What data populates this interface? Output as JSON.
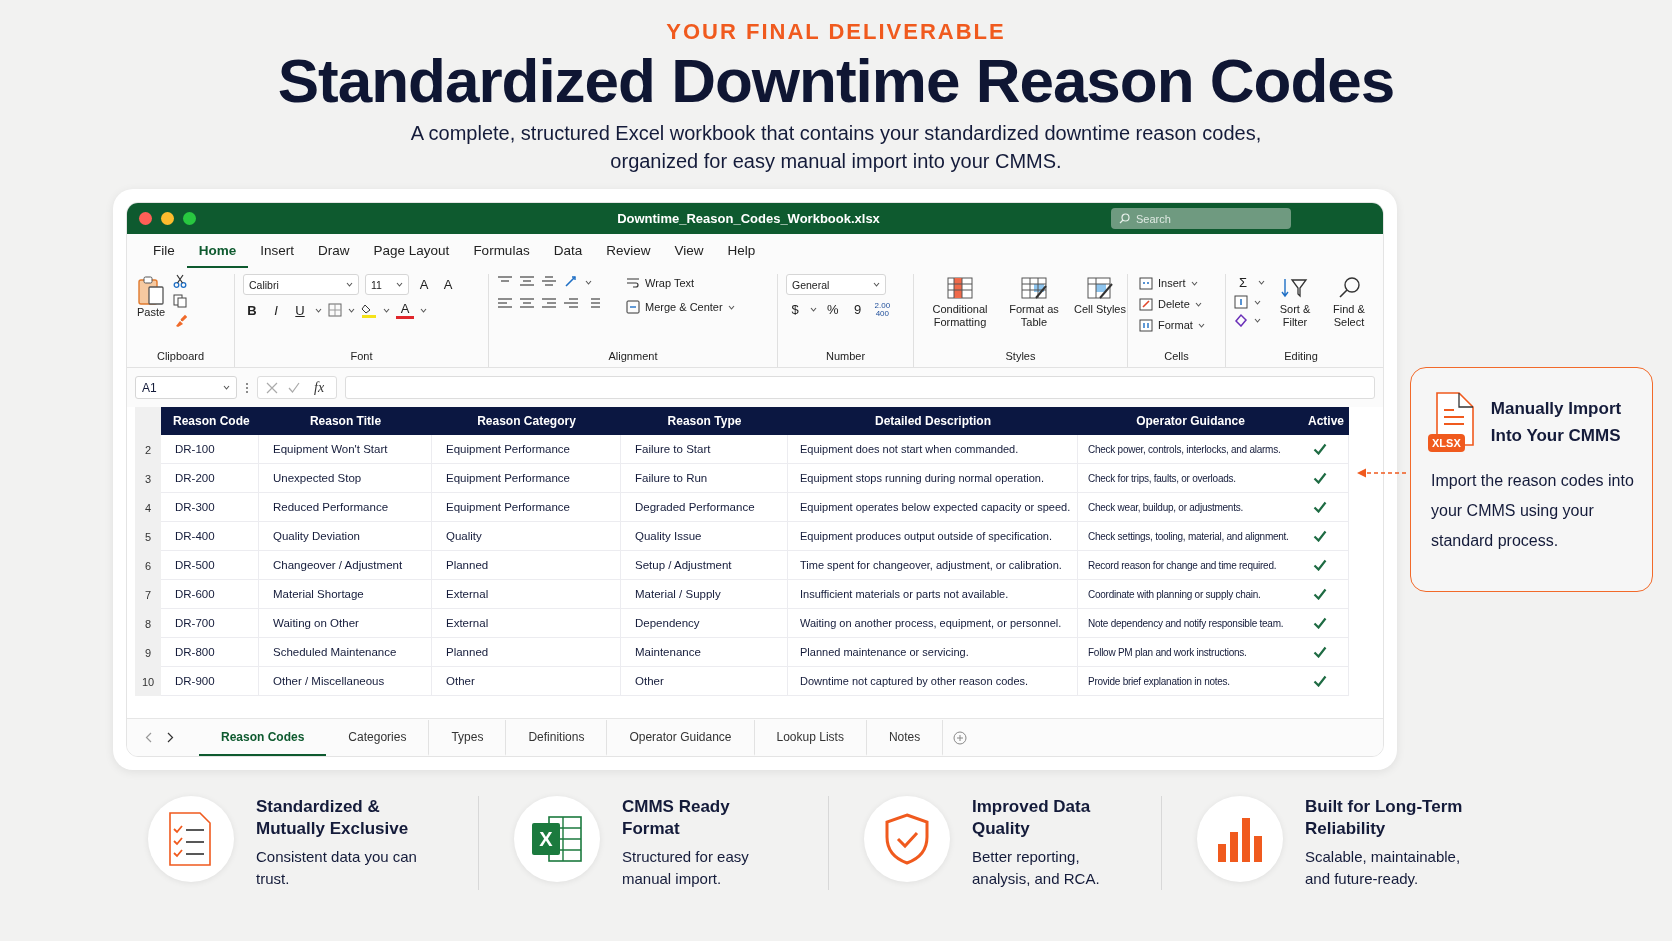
{
  "header": {
    "eyebrow": "YOUR FINAL DELIVERABLE",
    "title": "Standardized Downtime Reason Codes",
    "subtitle": "A complete, structured Excel workbook that contains your standardized downtime reason codes, organized for easy manual import into your CMMS."
  },
  "window": {
    "title": "Downtime_Reason_Codes_Workbook.xlsx",
    "search": {
      "placeholder": "Search"
    }
  },
  "menu": [
    {
      "label": "File",
      "selected": false
    },
    {
      "label": "Home",
      "selected": true
    },
    {
      "label": "Insert",
      "selected": false
    },
    {
      "label": "Draw",
      "selected": false
    },
    {
      "label": "Page Layout",
      "selected": false
    },
    {
      "label": "Formulas",
      "selected": false
    },
    {
      "label": "Data",
      "selected": false
    },
    {
      "label": "Review",
      "selected": false
    },
    {
      "label": "View",
      "selected": false
    },
    {
      "label": "Help",
      "selected": false
    }
  ],
  "ribbon": {
    "clipboard": {
      "paste": "Paste",
      "label": "Clipboard"
    },
    "font": {
      "name": "Calibri",
      "size": "11",
      "grow": "A",
      "shrink": "A",
      "bold": "B",
      "italic": "I",
      "underline": "U",
      "color_letter": "A",
      "label": "Font"
    },
    "alignment": {
      "wrap": "Wrap Text",
      "merge": "Merge & Center",
      "label": "Alignment"
    },
    "number": {
      "format": "General",
      "currency": "$",
      "percent": "%",
      "comma": "9",
      "decimal": [
        "2.00",
        "400"
      ],
      "label": "Number"
    },
    "styles": {
      "buttons": [
        "Conditional Formatting",
        "Format as Table",
        "Cell Styles"
      ],
      "label": "Styles"
    },
    "cells": {
      "buttons": [
        "Insert",
        "Delete",
        "Format"
      ],
      "label": "Cells"
    },
    "editing": {
      "sum": "Σ",
      "buttons": [
        "Sort & Filter",
        "Find & Select"
      ],
      "label": "Editing"
    }
  },
  "formula_bar": {
    "name_box": "A1",
    "fx": "fx"
  },
  "table": {
    "columns": [
      "Reason Code",
      "Reason Title",
      "Reason Category",
      "Reason Type",
      "Detailed Description",
      "Operator Guidance",
      "Active"
    ],
    "rows": [
      {
        "row_number": "2",
        "cells": [
          "DR-100",
          "Equipment Won't Start",
          "Equipment Performance",
          "Failure to Start",
          "Equipment does not start when commanded.",
          "Check power, controls, interlocks, and alarms."
        ],
        "active": true
      },
      {
        "row_number": "3",
        "cells": [
          "DR-200",
          "Unexpected Stop",
          "Equipment Performance",
          "Failure to Run",
          "Equipment stops running during normal operation.",
          "Check for trips, faults, or overloads."
        ],
        "active": true
      },
      {
        "row_number": "4",
        "cells": [
          "DR-300",
          "Reduced Performance",
          "Equipment Performance",
          "Degraded Performance",
          "Equipment operates below expected capacity or speed.",
          "Check wear, buildup, or adjustments."
        ],
        "active": true
      },
      {
        "row_number": "5",
        "cells": [
          "DR-400",
          "Quality Deviation",
          "Quality",
          "Quality Issue",
          "Equipment produces output outside of specification.",
          "Check settings, tooling, material, and alignment."
        ],
        "active": true
      },
      {
        "row_number": "6",
        "cells": [
          "DR-500",
          "Changeover / Adjustment",
          "Planned",
          "Setup / Adjustment",
          "Time spent for changeover, adjustment, or calibration.",
          "Record reason for change and time required."
        ],
        "active": true
      },
      {
        "row_number": "7",
        "cells": [
          "DR-600",
          "Material Shortage",
          "External",
          "Material / Supply",
          "Insufficient materials or parts not available.",
          "Coordinate with planning or supply chain."
        ],
        "active": true
      },
      {
        "row_number": "8",
        "cells": [
          "DR-700",
          "Waiting on Other",
          "External",
          "Dependency",
          "Waiting on another process, equipment, or personnel.",
          "Note dependency and notify responsible team."
        ],
        "active": true
      },
      {
        "row_number": "9",
        "cells": [
          "DR-800",
          "Scheduled Maintenance",
          "Planned",
          "Maintenance",
          "Planned maintenance or servicing.",
          "Follow PM plan and work instructions."
        ],
        "active": true
      },
      {
        "row_number": "10",
        "cells": [
          "DR-900",
          "Other / Miscellaneous",
          "Other",
          "Other",
          "Downtime not captured by other reason codes.",
          "Provide brief explanation in notes."
        ],
        "active": true
      }
    ]
  },
  "sheet_tabs": [
    {
      "label": "Reason Codes",
      "selected": true
    },
    {
      "label": "Categories",
      "selected": false
    },
    {
      "label": "Types",
      "selected": false
    },
    {
      "label": "Definitions",
      "selected": false
    },
    {
      "label": "Operator Guidance",
      "selected": false
    },
    {
      "label": "Lookup Lists",
      "selected": false
    },
    {
      "label": "Notes",
      "selected": false
    }
  ],
  "callout": {
    "badge": "XLSX",
    "title": "Manually Import Into Your CMMS",
    "text": "Import the reason codes into your CMMS using your standard process."
  },
  "features": [
    {
      "kind": "checklist",
      "title": "Standardized & Mutually Exclusive",
      "text": "Consistent data you can trust."
    },
    {
      "kind": "spreadsheet",
      "badge": "X",
      "title": "CMMS Ready Format",
      "text": "Structured for easy manual import."
    },
    {
      "kind": "shield",
      "title": "Improved Data Quality",
      "text": "Better reporting, analysis, and RCA."
    },
    {
      "kind": "chart",
      "title": "Built for Long-Term Reliability",
      "text": "Scalable, maintainable, and future-ready."
    }
  ]
}
